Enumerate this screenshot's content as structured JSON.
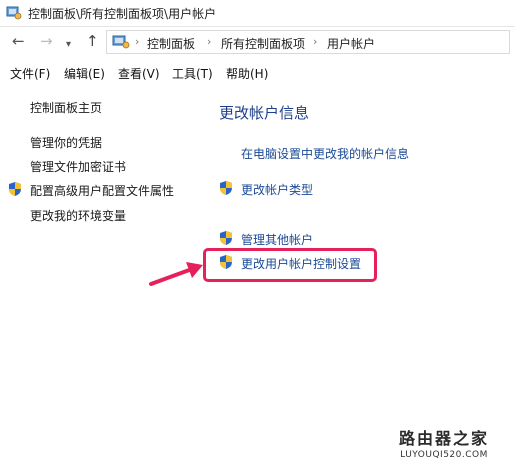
{
  "window": {
    "title": "控制面板\\所有控制面板项\\用户帐户"
  },
  "nav": {
    "back_icon": "back-arrow-icon",
    "forward_icon": "forward-arrow-icon",
    "recent_icon": "chevron-down-icon",
    "up_icon": "up-arrow-icon"
  },
  "address": {
    "breadcrumbs": [
      "控制面板",
      "所有控制面板项",
      "用户帐户"
    ]
  },
  "menu": {
    "items": [
      "文件(F)",
      "编辑(E)",
      "查看(V)",
      "工具(T)",
      "帮助(H)"
    ]
  },
  "sidebar": {
    "home": "控制面板主页",
    "items": [
      "管理你的凭据",
      "管理文件加密证书",
      "配置高级用户配置文件属性",
      "更改我的环境变量"
    ]
  },
  "main": {
    "heading": "更改帐户信息",
    "links": [
      "在电脑设置中更改我的帐户信息",
      "更改帐户类型",
      "管理其他帐户",
      "更改用户帐户控制设置"
    ]
  },
  "annotation": {
    "highlight_color": "#e6205b"
  },
  "watermark": {
    "name": "路由器之家",
    "url": "LUYOUQI520.COM"
  }
}
